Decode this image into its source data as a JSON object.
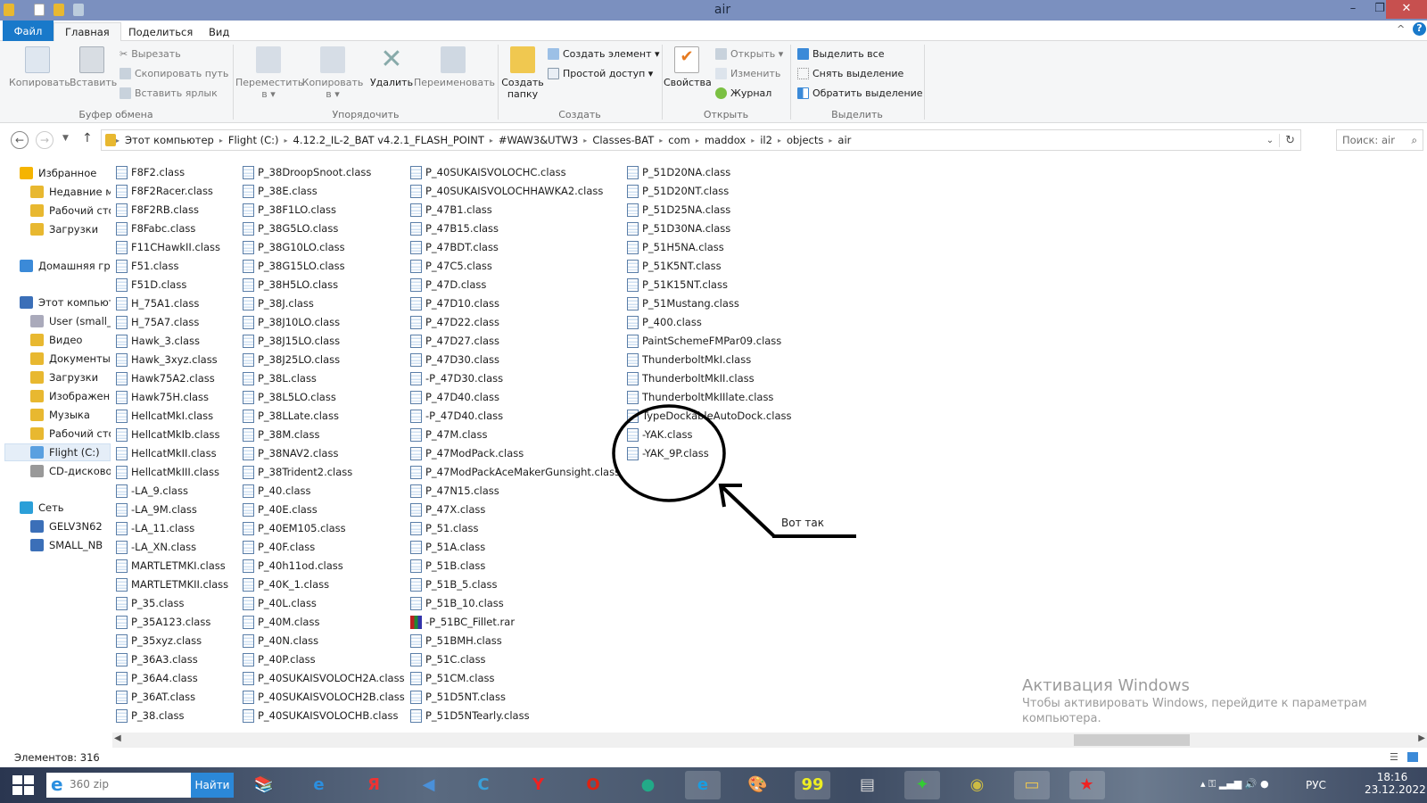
{
  "window": {
    "title": "air",
    "min": "–",
    "max": "❐",
    "close": "✕"
  },
  "tabs": {
    "file": "Файл",
    "home": "Главная",
    "share": "Поделиться",
    "view": "Вид"
  },
  "ribbon": {
    "copy": "Копировать",
    "paste": "Вставить",
    "cut": "Вырезать",
    "copy_path": "Скопировать путь",
    "paste_shortcut": "Вставить ярлык",
    "clipboard_group": "Буфер обмена",
    "move_to": "Переместить",
    "copy_to": "Копировать",
    "to_suffix": "в ▾",
    "delete": "Удалить",
    "rename": "Переименовать",
    "organize_group": "Упорядочить",
    "new_folder_1": "Создать",
    "new_folder_2": "папку",
    "new_item": "Создать элемент ▾",
    "easy_access": "Простой доступ ▾",
    "new_group": "Создать",
    "properties": "Свойства",
    "open": "Открыть ▾",
    "edit": "Изменить",
    "history": "Журнал",
    "open_group": "Открыть",
    "select_all": "Выделить все",
    "select_none": "Снять выделение",
    "invert_selection": "Обратить выделение",
    "select_group": "Выделить"
  },
  "address": {
    "crumbs": [
      "Этот компьютер",
      "Flight (C:)",
      "4.12.2_IL-2_BAT v4.2.1_FLASH_POINT",
      "#WAW3&UTW3",
      "Classes-BAT",
      "com",
      "maddox",
      "il2",
      "objects",
      "air"
    ],
    "search_placeholder": "Поиск: air"
  },
  "nav": [
    {
      "label": "Избранное",
      "icon": "star-icon",
      "level": 0
    },
    {
      "label": "Недавние места",
      "icon": "recent-places-icon",
      "level": 1
    },
    {
      "label": "Рабочий стол",
      "icon": "desktop-icon",
      "level": 1
    },
    {
      "label": "Загрузки",
      "icon": "downloads-folder-icon",
      "level": 1
    },
    {
      "label": "Домашняя группа",
      "icon": "homegroup-icon",
      "level": 0,
      "gap": true
    },
    {
      "label": "Этот компьютер",
      "icon": "computer-icon",
      "level": 0,
      "gap": true
    },
    {
      "label": "User (small_nb)",
      "icon": "network-drive-icon",
      "level": 1
    },
    {
      "label": "Видео",
      "icon": "videos-folder-icon",
      "level": 1
    },
    {
      "label": "Документы",
      "icon": "documents-folder-icon",
      "level": 1
    },
    {
      "label": "Загрузки",
      "icon": "downloads-folder-icon",
      "level": 1
    },
    {
      "label": "Изображения",
      "icon": "pictures-folder-icon",
      "level": 1
    },
    {
      "label": "Музыка",
      "icon": "music-folder-icon",
      "level": 1
    },
    {
      "label": "Рабочий стол",
      "icon": "desktop-folder-icon",
      "level": 1
    },
    {
      "label": "Flight (C:)",
      "icon": "drive-icon",
      "level": 1,
      "selected": true
    },
    {
      "label": "CD-дисковод",
      "icon": "cd-drive-icon",
      "level": 1
    },
    {
      "label": "Сеть",
      "icon": "network-icon",
      "level": 0,
      "gap": true
    },
    {
      "label": "GELV3N62",
      "icon": "computer-icon",
      "level": 1
    },
    {
      "label": "SMALL_NB",
      "icon": "computer-icon",
      "level": 1
    }
  ],
  "files": {
    "columns": [
      [
        "F8F2.class",
        "F8F2Racer.class",
        "F8F2RB.class",
        "F8Fabc.class",
        "F11CHawkII.class",
        "F51.class",
        "F51D.class",
        "H_75A1.class",
        "H_75A7.class",
        "Hawk_3.class",
        "Hawk_3xyz.class",
        "Hawk75A2.class",
        "Hawk75H.class",
        "HellcatMkI.class",
        "HellcatMkIb.class",
        "HellcatMkII.class",
        "HellcatMkIII.class",
        "-LA_9.class",
        "-LA_9M.class",
        "-LA_11.class",
        "-LA_XN.class",
        "MARTLETMKI.class",
        "MARTLETMKII.class",
        "P_35.class",
        "P_35A123.class",
        "P_35xyz.class",
        "P_36A3.class",
        "P_36A4.class",
        "P_36AT.class",
        "P_38.class"
      ],
      [
        "P_38DroopSnoot.class",
        "P_38E.class",
        "P_38F1LO.class",
        "P_38G5LO.class",
        "P_38G10LO.class",
        "P_38G15LO.class",
        "P_38H5LO.class",
        "P_38J.class",
        "P_38J10LO.class",
        "P_38J15LO.class",
        "P_38J25LO.class",
        "P_38L.class",
        "P_38L5LO.class",
        "P_38LLate.class",
        "P_38M.class",
        "P_38NAV2.class",
        "P_38Trident2.class",
        "P_40.class",
        "P_40E.class",
        "P_40EM105.class",
        "P_40F.class",
        "P_40h11od.class",
        "P_40K_1.class",
        "P_40L.class",
        "P_40M.class",
        "P_40N.class",
        "P_40P.class",
        "P_40SUKAISVOLOCH2A.class",
        "P_40SUKAISVOLOCH2B.class",
        "P_40SUKAISVOLOCHB.class"
      ],
      [
        "P_40SUKAISVOLOCHC.class",
        "P_40SUKAISVOLOCHHAWKA2.class",
        "P_47B1.class",
        "P_47B15.class",
        "P_47BDT.class",
        "P_47C5.class",
        "P_47D.class",
        "P_47D10.class",
        "P_47D22.class",
        "P_47D27.class",
        "P_47D30.class",
        "-P_47D30.class",
        "P_47D40.class",
        "-P_47D40.class",
        "P_47M.class",
        "P_47ModPack.class",
        "P_47ModPackAceMakerGunsight.class",
        "P_47N15.class",
        "P_47X.class",
        "P_51.class",
        "P_51A.class",
        "P_51B.class",
        "P_51B_5.class",
        "P_51B_10.class",
        "-P_51BC_Fillet.rar",
        "P_51BMH.class",
        "P_51C.class",
        "P_51CM.class",
        "P_51D5NT.class",
        "P_51D5NTearly.class"
      ],
      [
        "P_51D20NA.class",
        "P_51D20NT.class",
        "P_51D25NA.class",
        "P_51D30NA.class",
        "P_51H5NA.class",
        "P_51K5NT.class",
        "P_51K15NT.class",
        "P_51Mustang.class",
        "P_400.class",
        "PaintSchemeFMPar09.class",
        "ThunderboltMkI.class",
        "ThunderboltMkII.class",
        "ThunderboltMkIIlate.class",
        "TypeDockableAutoDock.class",
        "-YAK.class",
        "-YAK_9P.class"
      ]
    ]
  },
  "annotation": {
    "text": "Вот так"
  },
  "status": {
    "items": "Элементов: 316"
  },
  "watermark": {
    "title": "Активация Windows",
    "line1": "Чтобы активировать Windows, перейдите к параметрам",
    "line2": "компьютера."
  },
  "taskbar": {
    "search_value": "360 zip",
    "find": "Найти",
    "lang": "РУС",
    "time": "18:16",
    "date": "23.12.2022",
    "apps": [
      {
        "icon": "winrar-icon",
        "g": "📚",
        "c": "#c8a060"
      },
      {
        "icon": "internet-explorer-icon",
        "g": "e",
        "c": "#2b8fe0"
      },
      {
        "icon": "yandex-icon",
        "g": "Я",
        "c": "#e33"
      },
      {
        "icon": "audio-app-icon",
        "g": "◀",
        "c": "#4a90d9"
      },
      {
        "icon": "ccleaner-icon",
        "g": "C",
        "c": "#3a9fd8"
      },
      {
        "icon": "yandex-browser-icon",
        "g": "Y",
        "c": "#e22"
      },
      {
        "icon": "opera-icon",
        "g": "O",
        "c": "#d21"
      },
      {
        "icon": "chrome-icon",
        "g": "●",
        "c": "#2a8"
      },
      {
        "icon": "edge-icon",
        "g": "e",
        "c": "#1a9de0"
      },
      {
        "icon": "paint-icon",
        "g": "🎨",
        "c": "#ccc"
      },
      {
        "icon": "monitor-app-icon",
        "g": "99",
        "c": "#ee2"
      },
      {
        "icon": "system-monitor-icon",
        "g": "▤",
        "c": "#ddd"
      },
      {
        "icon": "feather-app-icon",
        "g": "✦",
        "c": "#3c3"
      },
      {
        "icon": "eye-app-icon",
        "g": "◉",
        "c": "#cb4"
      },
      {
        "icon": "file-explorer-icon",
        "g": "▭",
        "c": "#f0c850"
      },
      {
        "icon": "il2-star-icon",
        "g": "★",
        "c": "#e22"
      }
    ]
  }
}
